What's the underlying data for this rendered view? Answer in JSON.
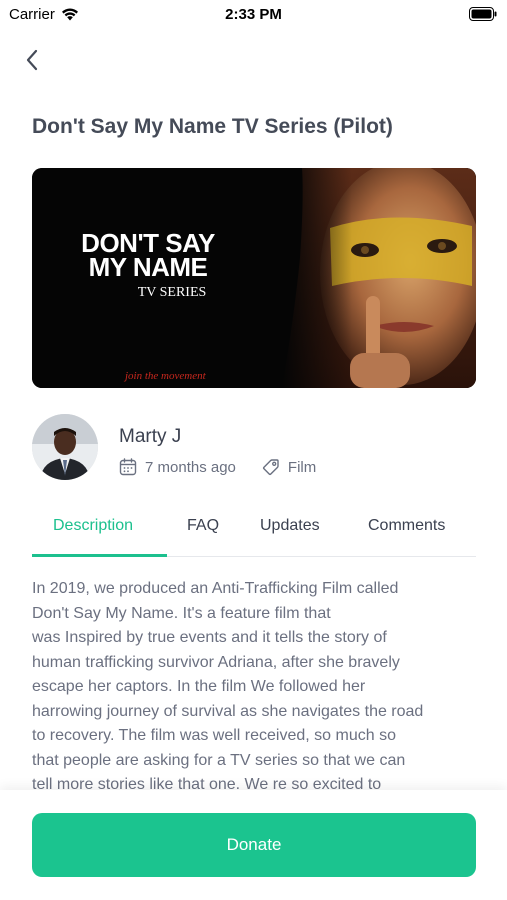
{
  "status_bar": {
    "carrier": "Carrier",
    "time": "2:33 PM"
  },
  "page": {
    "title": "Don't Say My Name TV Series (Pilot)"
  },
  "hero": {
    "logo_line1": "DON'T SAY",
    "logo_line2": "MY NAME",
    "subtitle": "TV SERIES",
    "tagline": "join the movement"
  },
  "author": {
    "name": "Marty J",
    "posted": "7 months ago",
    "category": "Film"
  },
  "tabs": [
    {
      "label": "Description",
      "active": true
    },
    {
      "label": "FAQ",
      "active": false
    },
    {
      "label": "Updates",
      "active": false
    },
    {
      "label": "Comments",
      "active": false
    }
  ],
  "description": "In 2019, we produced an Anti-Trafficking Film called\nDon't Say My Name.  It's a feature film that\nwas Inspired by true events and it tells the story of\nhuman trafficking survivor Adriana, after she bravely\nescape her captors.  In the film We  followed her\nharrowing journey of survival as she navigates the road\nto recovery.  The film was well received, so much so\nthat people are asking for a TV series so that we can\ntell more stories like that one.  We re so excited to",
  "footer": {
    "donate_label": "Donate"
  },
  "colors": {
    "accent": "#1cc08e",
    "button": "#1bc48f",
    "text": "#454b58",
    "muted": "#6b7080"
  }
}
